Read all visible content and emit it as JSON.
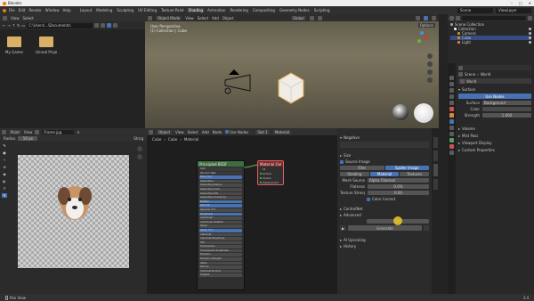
{
  "titlebar": {
    "app": "Blender",
    "controls": [
      "–",
      "□",
      "✕"
    ]
  },
  "menubar": {
    "items": [
      "File",
      "Edit",
      "Render",
      "Window",
      "Help"
    ]
  },
  "workspace_tabs": [
    "Layout",
    "Modeling",
    "Sculpting",
    "UV Editing",
    "Texture Paint",
    "Shading",
    "Animation",
    "Rendering",
    "Compositing",
    "Geometry Nodes",
    "Scripting"
  ],
  "workspace_active": 5,
  "scene": {
    "label": "Scene",
    "view_layer": "ViewLayer"
  },
  "filebrowser": {
    "menu": [
      "View",
      "Select"
    ],
    "path": "C:\\Users\\...\\Documents\\",
    "folders": [
      "My Games",
      "Unreal Projects"
    ]
  },
  "viewport": {
    "mode": "Object Mode",
    "menu": [
      "View",
      "Select",
      "Add",
      "Object"
    ],
    "shading": "Global",
    "info_line1": "User Perspective",
    "info_line2": "(1) Collection | Cube",
    "options": "Options"
  },
  "outliner": {
    "title": "Scene Collection",
    "items": [
      "Collection",
      "Camera",
      "Cube",
      "Light"
    ]
  },
  "properties": {
    "scene": "Scene",
    "world_name": "World",
    "surface_header": "Surface",
    "use_nodes": "Use Nodes",
    "surface_label": "Surface",
    "surface_value": "Background",
    "color_label": "Color",
    "strength_label": "Strength",
    "strength_value": "1.000",
    "sections": [
      "Volume",
      "Mist Pass",
      "Viewport Display",
      "Custom Properties"
    ]
  },
  "image_editor": {
    "mode": "Paint",
    "menu": [
      "View"
    ],
    "image_name": "Frame.jpg",
    "brush": "Radius",
    "brush_size": "50 px",
    "falloff": "Strng"
  },
  "node_editor": {
    "mode": "Object",
    "menu": [
      "View",
      "Select",
      "Add",
      "Node"
    ],
    "use_nodes": "Use Nodes",
    "slot": "Slot 1",
    "material": "Material",
    "breadcrumbs": [
      "Cube",
      "Cube",
      "Material"
    ],
    "bsdf_title": "Principled BSDF",
    "output_title": "Material Output",
    "output_sockets": [
      "All",
      "Surface",
      "Volume",
      "Displacement"
    ],
    "bsdf_rows": [
      "GGX",
      "Random Walk",
      "Base Color",
      "Subsurface",
      "Subsurface Radius",
      "Subsurface Color",
      "Subsurface IOR",
      "Subsurface Anisotropy",
      "Metallic",
      "Specular",
      "Specular Tint",
      "Roughness",
      "Anisotropic",
      "Anisotropic Rotation",
      "Sheen",
      "Sheen Tint",
      "Clearcoat",
      "Clearcoat Roughness",
      "IOR",
      "Transmission",
      "Transmission Roughness",
      "Emission",
      "Emission Strength",
      "Alpha",
      "Normal",
      "Clearcoat Normal",
      "Tangent"
    ]
  },
  "sidebar": {
    "negative": "Negative",
    "size": "Size",
    "source_image": "Source Image",
    "buttons_row1": [
      "Files",
      "Spider Image"
    ],
    "buttons_row2": [
      "Shading",
      "Material",
      "Textures"
    ],
    "mesh_source": "Mesh Source",
    "mesh_source_value": "Alpha Channel",
    "fields": [
      [
        "Flatness",
        "0.0%"
      ],
      [
        "Texture Strength",
        "0.00"
      ]
    ],
    "color_correct": "Color Correct",
    "controlnet": "ControlNet",
    "advanced": "Advanced",
    "generate": "Generate",
    "ai_upscaling": "AI Upscaling",
    "history": "History"
  },
  "statusbar": {
    "left": "Pan View",
    "right": "3.4"
  },
  "colors": {
    "accent": "#4772b3",
    "header": "#303030",
    "panel": "#282828",
    "nodeGreen": "#3d6e3f",
    "nodeRed": "#7d2a2a"
  }
}
